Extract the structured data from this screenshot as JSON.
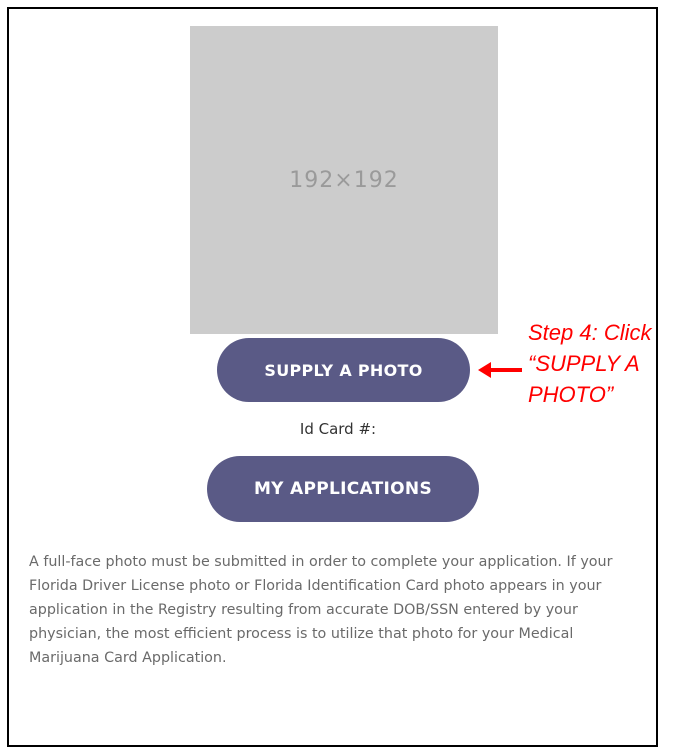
{
  "photo": {
    "placeholder_text": "192×192"
  },
  "buttons": {
    "supply_photo": "SUPPLY A PHOTO",
    "my_applications": "MY APPLICATIONS"
  },
  "id_card_label": "Id Card #:",
  "annotation": {
    "text": "Step 4: Click “SUPPLY A PHOTO”",
    "color": "#ff0000"
  },
  "description": "A full-face photo must be submitted in order to complete your application. If your Florida Driver License photo or Florida Identification Card photo appears in your application in the Registry resulting from accurate DOB/SSN entered by your physician, the most efficient process is to utilize that photo for your Medical Marijuana Card Application.",
  "colors": {
    "button_bg": "#5a5a86",
    "placeholder_bg": "#cccccc",
    "text_gray": "#6a6a6a"
  },
  "icons": {
    "arrow": "left-arrow-icon"
  }
}
